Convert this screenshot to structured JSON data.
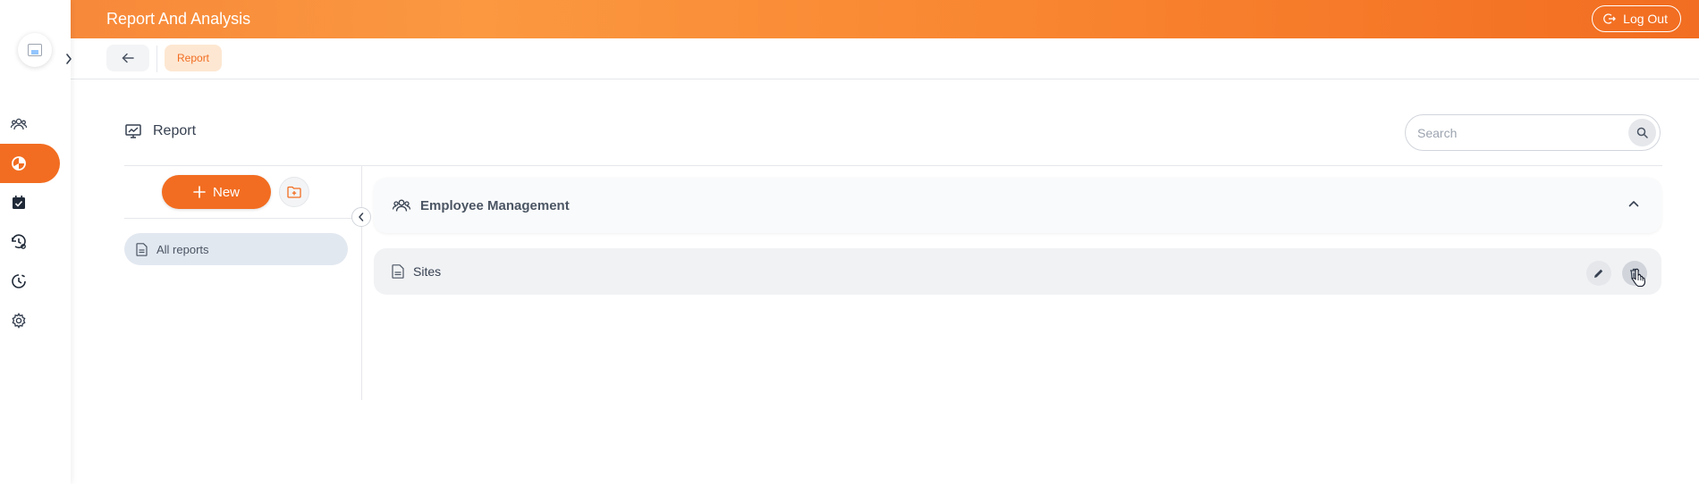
{
  "header": {
    "title": "Report And Analysis",
    "logout_label": "Log Out"
  },
  "breadcrumb": {
    "items": [
      "Report"
    ]
  },
  "sidebar": {
    "items": [
      {
        "icon": "users-icon",
        "active": false
      },
      {
        "icon": "report-chart-icon",
        "active": true
      },
      {
        "icon": "calendar-check-icon",
        "active": false
      },
      {
        "icon": "history-settings-icon",
        "active": false
      },
      {
        "icon": "clock-history-icon",
        "active": false
      },
      {
        "icon": "gear-icon",
        "active": false
      }
    ]
  },
  "page": {
    "title": "Report",
    "search_placeholder": "Search"
  },
  "left_panel": {
    "new_button_label": "New",
    "all_reports_label": "All reports"
  },
  "groups": [
    {
      "title": "Employee Management",
      "expanded": true,
      "reports": [
        {
          "name": "Sites"
        }
      ]
    }
  ],
  "colors": {
    "accent": "#f26d21",
    "header_gradient_start": "#f7893a",
    "header_gradient_end": "#f26d21",
    "breadcrumb_bg": "#fde7d2",
    "selected_item_bg": "#e2e8f0"
  }
}
